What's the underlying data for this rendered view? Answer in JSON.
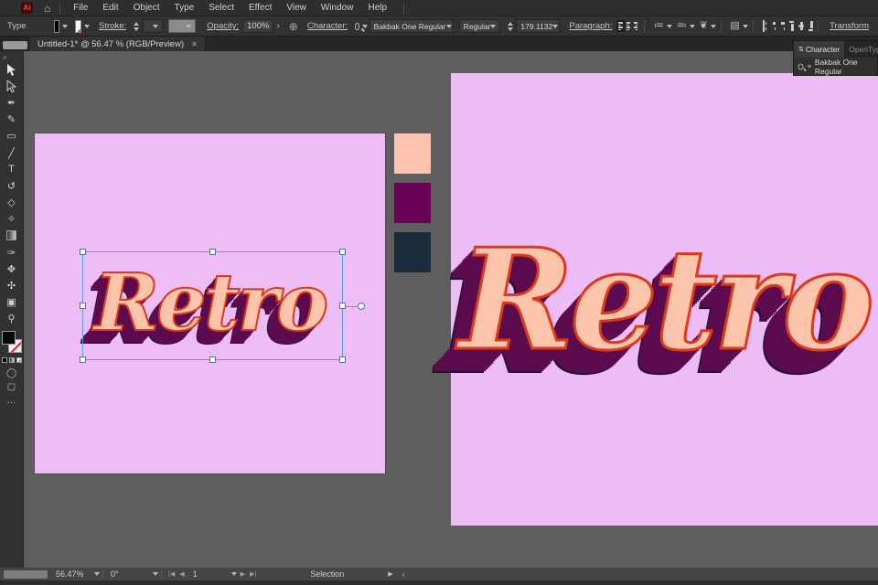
{
  "menubar": {
    "items": [
      "File",
      "Edit",
      "Object",
      "Type",
      "Select",
      "Effect",
      "View",
      "Window",
      "Help"
    ]
  },
  "controlbar": {
    "context_label": "Type",
    "stroke_label": "Stroke:",
    "opacity_label": "Opacity:",
    "opacity_value": "100%",
    "character_label": "Character:",
    "font_name": "Bakbak One Regular",
    "font_style": "Regular",
    "font_size": "179.1132",
    "paragraph_label": "Paragraph:",
    "transform_label": "Transform"
  },
  "tabbar": {
    "document_tab": "Untitled-1* @ 56.47 % (RGB/Preview)"
  },
  "character_panel": {
    "tab_character": "Character",
    "tab_opentype": "OpenType",
    "font_query": "Bakbak One Regular"
  },
  "canvas": {
    "word": "Retro",
    "artboard_color": "#EFBDF6",
    "preview_color": "#EDBBF5",
    "text_fill": "#FBC4AB",
    "text_outline": "#DC3A1B",
    "text_shadow": "#5C0C4E",
    "swatches": [
      {
        "name": "peach",
        "color": "#FDC5AE"
      },
      {
        "name": "purple",
        "color": "#6A0154"
      },
      {
        "name": "navy",
        "color": "#1B2B3B"
      }
    ]
  },
  "toolbar": {
    "collapse": "»",
    "tools": [
      {
        "name": "selection-tool",
        "glyph": ""
      },
      {
        "name": "direct-selection-tool",
        "glyph": ""
      },
      {
        "name": "pen-tool",
        "glyph": "✒"
      },
      {
        "name": "curvature-tool",
        "glyph": "✎"
      },
      {
        "name": "rectangle-tool",
        "glyph": "▭"
      },
      {
        "name": "line-segment-tool",
        "glyph": "╱"
      },
      {
        "name": "type-tool",
        "glyph": "T"
      },
      {
        "name": "rotate-tool",
        "glyph": "↺"
      },
      {
        "name": "eraser-tool",
        "glyph": "◇"
      },
      {
        "name": "shaper-tool",
        "glyph": "✧"
      },
      {
        "name": "gradient-tool",
        "glyph": ""
      },
      {
        "name": "eyedropper-tool",
        "glyph": "✑"
      },
      {
        "name": "hand-tool",
        "glyph": "✥"
      },
      {
        "name": "blend-tool",
        "glyph": "✣"
      },
      {
        "name": "artboard-tool",
        "glyph": "▣"
      },
      {
        "name": "zoom-tool",
        "glyph": "⚲"
      }
    ],
    "more": "…"
  },
  "statusbar": {
    "zoom": "56.47%",
    "rotation": "0°",
    "artboard_number": "1",
    "status": "Selection"
  },
  "icons": {
    "logo": "Ai",
    "home": "⌂",
    "gt": "›",
    "globe": "⊕",
    "close": "✕",
    "panel_sort": "⇅",
    "bullet_list": "≔",
    "numbered_list": "≕",
    "ornament": "❦",
    "doc": "▤",
    "nav_first": "|◀",
    "nav_prev": "◀",
    "nav_next": "▶",
    "nav_last": "▶|",
    "arrow_right_small": "▶",
    "angle_left": "‹"
  }
}
